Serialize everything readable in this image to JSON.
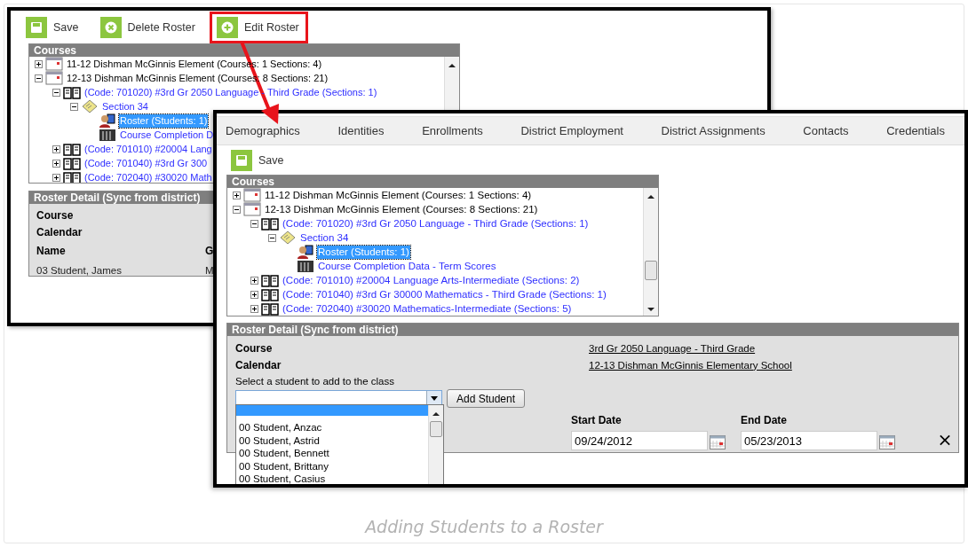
{
  "back_window": {
    "toolbar": [
      {
        "label": "Save",
        "kind": "save",
        "highlighted": false
      },
      {
        "label": "Delete Roster",
        "kind": "delete",
        "highlighted": false
      },
      {
        "label": "Edit Roster",
        "kind": "add",
        "highlighted": true
      }
    ],
    "courses": {
      "title": "Courses",
      "tree": [
        {
          "label": "11-12 Dishman McGinnis Element (Courses: 1 Sections: 4)",
          "kind": "calendar",
          "expanded": false,
          "selected": false
        },
        {
          "label": "12-13 Dishman McGinnis Element (Courses: 8 Sections: 21)",
          "kind": "calendar",
          "expanded": true,
          "selected": false,
          "children": [
            {
              "label": "(Code: 701020) #3rd Gr 2050 Language - Third Grade (Sections: 1)",
              "kind": "course",
              "expanded": true,
              "selected": false,
              "children": [
                {
                  "label": "Section 34",
                  "kind": "section",
                  "expanded": true,
                  "selected": false,
                  "children": [
                    {
                      "label": "Roster (Students: 1)",
                      "kind": "roster",
                      "selected": true
                    },
                    {
                      "label": "Course Completion D",
                      "kind": "scores",
                      "selected": false
                    }
                  ]
                }
              ]
            },
            {
              "label": "(Code: 701010) #20004 Lang",
              "kind": "course",
              "expanded": false,
              "selected": false
            },
            {
              "label": "(Code: 701040) #3rd Gr 300",
              "kind": "course",
              "expanded": false,
              "selected": false
            },
            {
              "label": "(Code: 702040) #30020 Math",
              "kind": "course",
              "expanded": false,
              "selected": false
            }
          ]
        }
      ]
    },
    "roster_detail": {
      "title": "Roster Detail (Sync from district)",
      "fields": [
        "Course",
        "Calendar"
      ],
      "columns": [
        "Name",
        "G"
      ],
      "rows": [
        [
          "03 Student, James",
          "M"
        ]
      ]
    }
  },
  "front_window": {
    "tabs": [
      {
        "label": "Demographics",
        "selected": false
      },
      {
        "label": "Identities",
        "selected": false
      },
      {
        "label": "Enrollments",
        "selected": false
      },
      {
        "label": "District Employment",
        "selected": false
      },
      {
        "label": "District Assignments",
        "selected": false
      },
      {
        "label": "Contacts",
        "selected": false
      },
      {
        "label": "Credentials",
        "selected": false
      }
    ],
    "toolbar": [
      {
        "label": "Save",
        "kind": "save",
        "highlighted": false
      }
    ],
    "courses": {
      "title": "Courses",
      "tree": [
        {
          "label": "11-12 Dishman McGinnis Element (Courses: 1 Sections: 4)",
          "kind": "calendar",
          "expanded": false,
          "selected": false
        },
        {
          "label": "12-13 Dishman McGinnis Element (Courses: 8 Sections: 21)",
          "kind": "calendar",
          "expanded": true,
          "selected": false,
          "children": [
            {
              "label": "(Code: 701020) #3rd Gr 2050 Language - Third Grade (Sections: 1)",
              "kind": "course",
              "expanded": true,
              "selected": false,
              "children": [
                {
                  "label": "Section 34",
                  "kind": "section",
                  "expanded": true,
                  "selected": false,
                  "children": [
                    {
                      "label": "Roster (Students: 1)",
                      "kind": "roster",
                      "selected": true
                    },
                    {
                      "label": "Course Completion Data - Term Scores",
                      "kind": "scores",
                      "selected": false
                    }
                  ]
                }
              ]
            },
            {
              "label": "(Code: 701010) #20004 Language Arts-Intermediate (Sections: 2)",
              "kind": "course",
              "expanded": false,
              "selected": false
            },
            {
              "label": "(Code: 701040) #3rd Gr 30000 Mathematics - Third Grade (Sections: 1)",
              "kind": "course",
              "expanded": false,
              "selected": false
            },
            {
              "label": "(Code: 702040) #30020 Mathematics-Intermediate (Sections: 5)",
              "kind": "course",
              "expanded": false,
              "selected": false
            }
          ]
        }
      ]
    },
    "roster_detail": {
      "title": "Roster Detail (Sync from district)",
      "fields": [
        {
          "label": "Course",
          "value": "3rd Gr 2050 Language - Third Grade"
        },
        {
          "label": "Calendar",
          "value": "12-13 Dishman McGinnis Elementary School"
        }
      ],
      "student_select": {
        "label": "Select a student to add to the class",
        "open": true,
        "blank_option_highlighted": true,
        "options": [
          "00 Student, Anzac",
          "00 Student, Astrid",
          "00 Student, Bennett",
          "00 Student, Brittany",
          "00 Student, Casius"
        ]
      },
      "add_button": "Add Student",
      "dates": [
        {
          "label": "Start Date",
          "value": "09/24/2012"
        },
        {
          "label": "End Date",
          "value": "05/23/2013"
        }
      ]
    }
  },
  "caption": "Adding Students to a Roster"
}
